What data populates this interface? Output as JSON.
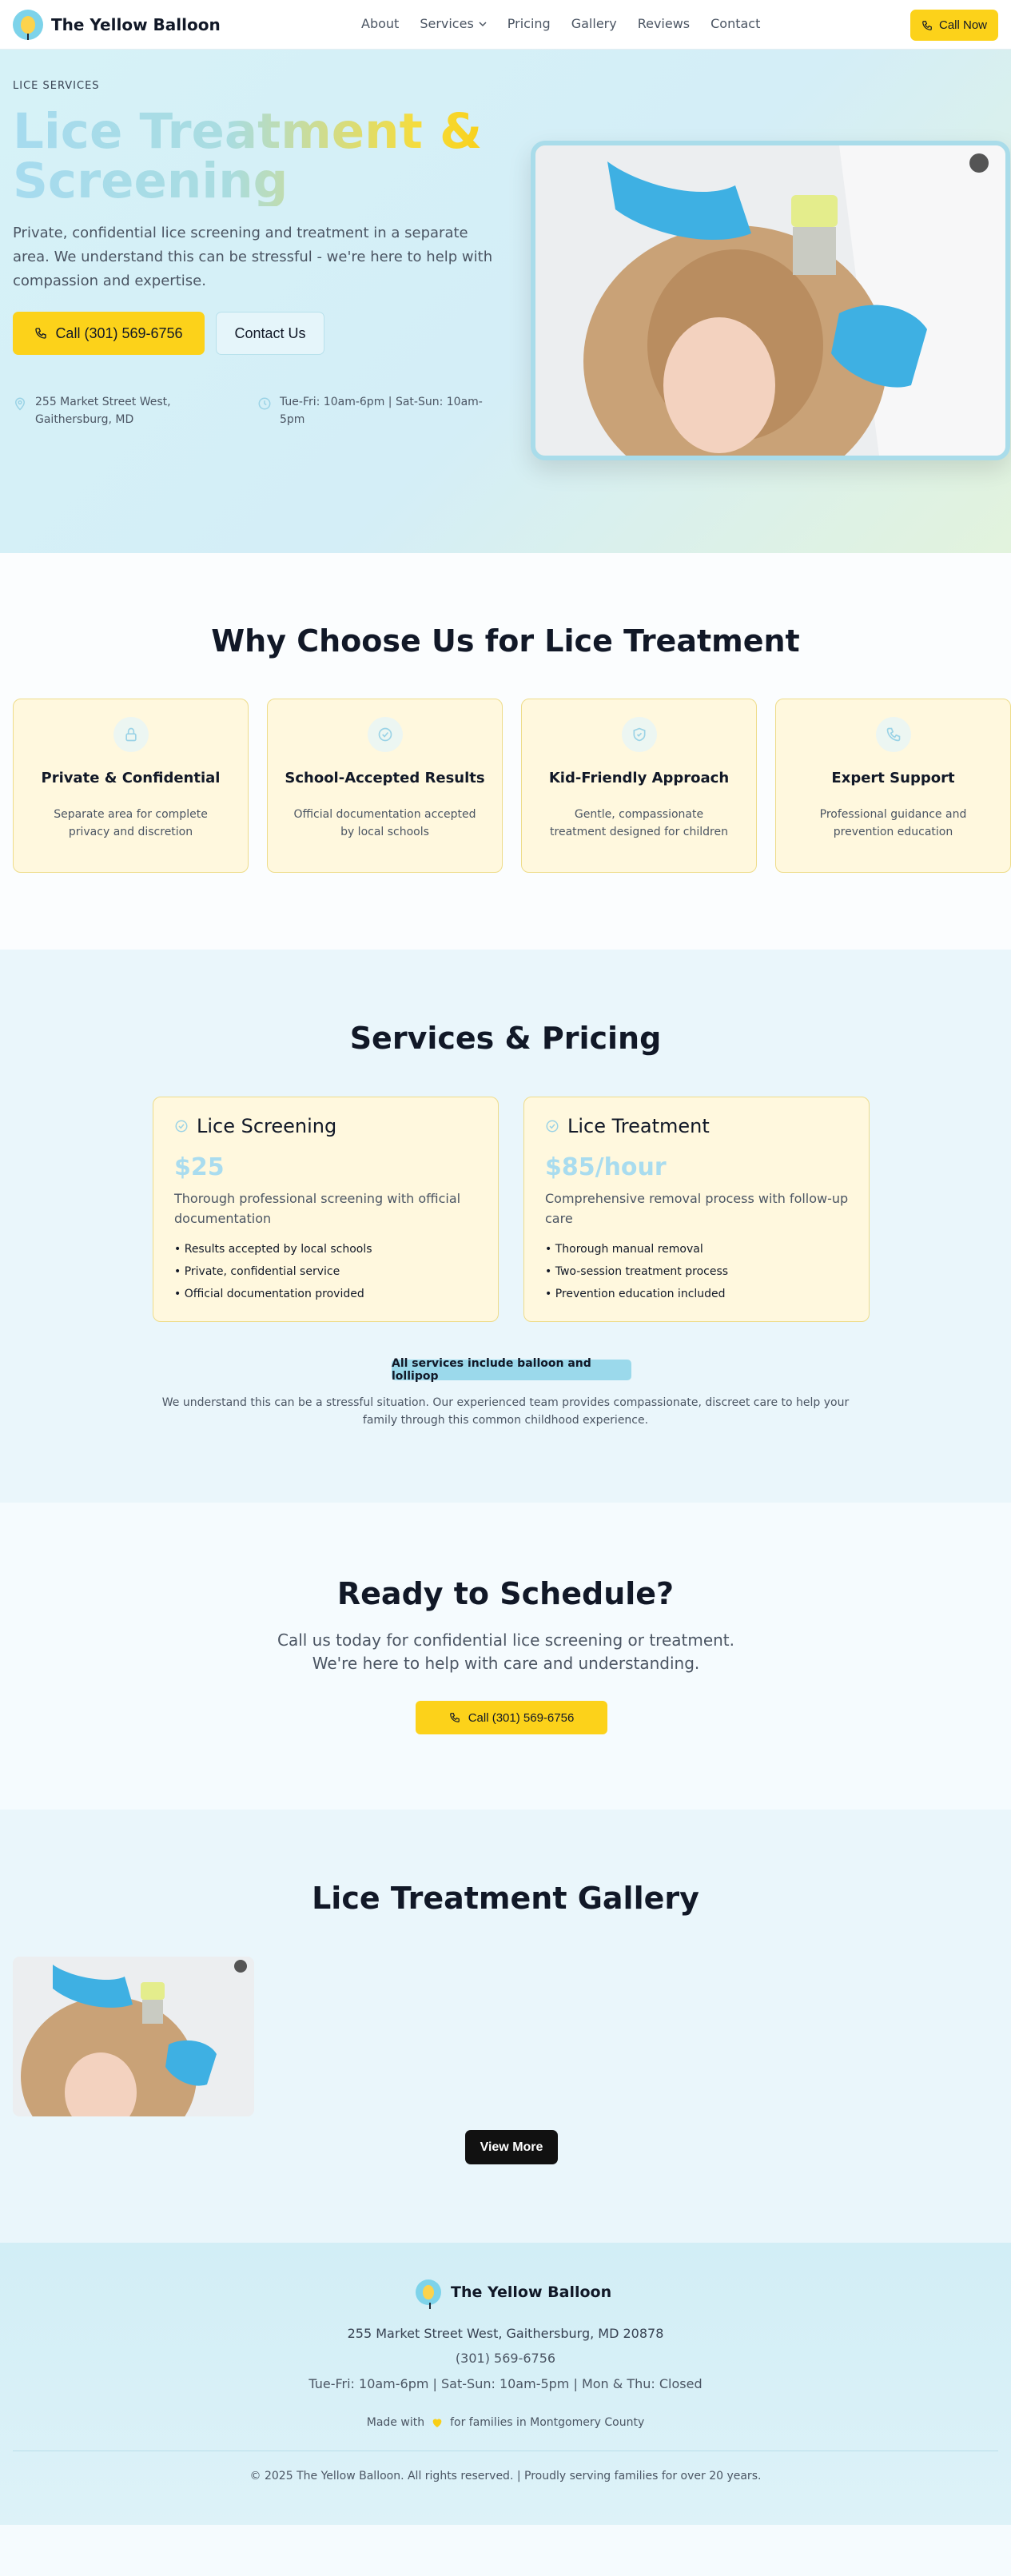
{
  "nav": {
    "brand": "The Yellow Balloon",
    "links": [
      "About",
      "Services",
      "Pricing",
      "Gallery",
      "Reviews",
      "Contact"
    ],
    "cta": "Call Now"
  },
  "hero": {
    "eyebrow": "LICE SERVICES",
    "title_line1": "Lice Treatment &",
    "title_line2": "Screening",
    "lead": "Private, confidential lice screening and treatment in a separate area. We understand this can be stressful - we're here to help with compassion and expertise.",
    "call_label": "Call (301) 569-6756",
    "contact_label": "Contact Us",
    "address": "255 Market Street West, Gaithersburg, MD",
    "hours": "Tue-Fri: 10am-6pm | Sat-Sun: 10am-5pm"
  },
  "why": {
    "title": "Why Choose Us for Lice Treatment",
    "cards": [
      {
        "title": "Private & Confidential",
        "text": "Separate area for complete privacy and discretion",
        "icon": "lock-icon"
      },
      {
        "title": "School-Accepted Results",
        "text": "Official documentation accepted by local schools",
        "icon": "check-circle-icon"
      },
      {
        "title": "Kid-Friendly Approach",
        "text": "Gentle, compassionate treatment designed for children",
        "icon": "shield-check-icon"
      },
      {
        "title": "Expert Support",
        "text": "Professional guidance and prevention education",
        "icon": "phone-icon"
      }
    ]
  },
  "services": {
    "title": "Services & Pricing",
    "items": [
      {
        "name": "Lice Screening",
        "price": "$25",
        "desc": "Thorough professional screening with official documentation",
        "features": [
          "Results accepted by local schools",
          "Private, confidential service",
          "Official documentation provided"
        ]
      },
      {
        "name": "Lice Treatment",
        "price": "$85/hour",
        "desc": "Comprehensive removal process with follow-up care",
        "features": [
          "Thorough manual removal",
          "Two-session treatment process",
          "Prevention education included"
        ]
      }
    ],
    "badge": "All services include balloon and lollipop",
    "note": "We understand this can be a stressful situation. Our experienced team provides compassionate, discreet care to help your family through this common childhood experience."
  },
  "schedule": {
    "title": "Ready to Schedule?",
    "text": "Call us today for confidential lice screening or treatment. We're here to help with care and understanding.",
    "cta": "Call (301) 569-6756"
  },
  "gallery": {
    "title": "Lice Treatment Gallery",
    "view_more": "View More"
  },
  "footer": {
    "brand": "The Yellow Balloon",
    "address": "255 Market Street West, Gaithersburg, MD 20878",
    "phone": "(301) 569-6756",
    "hours": "Tue-Fri: 10am-6pm | Sat-Sun: 10am-5pm | Mon & Thu: Closed",
    "made_prefix": "Made with",
    "made_suffix": "for families in Montgomery County",
    "copyright": "© 2025 The Yellow Balloon. All rights reserved. | Proudly serving families for over 20 years."
  },
  "colors": {
    "accent": "#fcd21a",
    "sky": "#a9dcef",
    "card_bg": "#fff8de"
  }
}
